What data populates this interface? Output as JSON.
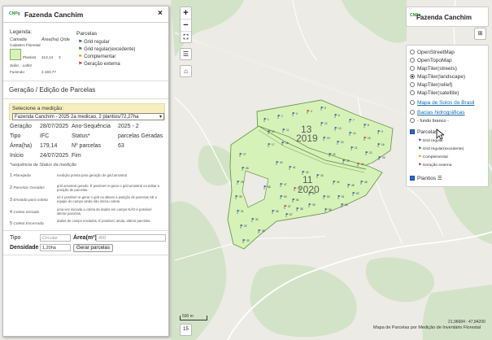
{
  "panel": {
    "title": "Fazenda Canchim",
    "logo_text": "CNPq",
    "legend": {
      "title": "Legenda:",
      "camada": "Camada",
      "area_qtde": "Área(ha) Qtde",
      "cadastro": "Cadastro Florestal",
      "plantios_label": "Plantios",
      "plantios_area": "413,14",
      "plantios_qtd": "3",
      "solos": "Solos - Lotlnt",
      "parcelas_col": "Fuzendo",
      "parcelas_val": "2.193,77",
      "parcelas_title": "Parcelas",
      "parcelas": [
        {
          "label": "Grid regular",
          "color": "#1a5fb4"
        },
        {
          "label": "Grid regular(excedente)",
          "color": "#2e7d32"
        },
        {
          "label": "Complementar",
          "color": "#f0a000"
        },
        {
          "label": "Geração externa",
          "color": "#d32f2f"
        }
      ]
    },
    "section_title": "Geração / Edição de Parcelas",
    "select_label": "Selecione a medição:",
    "select_value": "Fazenda Canchim - 2025 2a medicao, 2 plantios/72,27ha",
    "info": {
      "geracao_k": "Geração",
      "geracao_v": "28/07/2025",
      "ano_k": "Ano-Sequência",
      "ano_v": "2025 - 2",
      "tipo_k": "Tipo",
      "tipo_v": "IFC",
      "status_k": "Status*",
      "status_v": "parcelas Geradas",
      "area_k": "Área(ha)",
      "area_v": "179,14",
      "nparc_k": "Nº parcelas",
      "nparc_v": "63",
      "inicio_k": "Início",
      "inicio_v": "24/07/2025",
      "fim_k": "Fim",
      "fim_v": ""
    },
    "status_note": "*sequência de Status da medição",
    "statuses": [
      {
        "n": "1",
        "label": "Planejada",
        "desc": "medição pronta para geração de grid amostral"
      },
      {
        "n": "2",
        "label": "Parcelas Geradas",
        "desc": "grid amostral gerado. É possível re-gerar o grid amostral ou editar a posição de parcelas."
      },
      {
        "n": "3",
        "label": "Enviada para coleta",
        "desc": "só é possível re-gerar o grid ou alterar a posição de parcelas SE o equipe do campo ainda não iniciou coleta"
      },
      {
        "n": "4",
        "label": "Coleta Iniciada",
        "desc": "uma vez iniciada a coleta de dados em campo NÃO é possível alterar parcelas."
      },
      {
        "n": "5",
        "label": "Coleta Encerrada",
        "desc": "dados de campo enviados. É possível, ainda, alterar parcelas."
      }
    ],
    "tipo_label": "Tipo",
    "tipo_value": "Circular",
    "area_label": "Área(m²)",
    "area_value": "400",
    "densidade_label": "Densidade",
    "densidade_value": "1,20ha",
    "gerar_button": "Gerar parcelas"
  },
  "map": {
    "zoom_in": "+",
    "zoom_out": "−",
    "fullscreen_icon": "fullscreen-icon",
    "layers_icon": "list-icon",
    "home_icon": "home-icon",
    "compass_icon": "compass-icon",
    "plot1_label": "13",
    "plot1_year": "2019",
    "plot2_label": "11",
    "plot2_year": "2020",
    "scale_label": "500 m",
    "bottom_btn": "15",
    "coords": "21,96684 : 47,84200",
    "attribution": "Mapa de Parcelas por Medição de Inventário Florestal"
  },
  "titlebox": {
    "logo": "CNPq",
    "title": "Fazenda Canchim"
  },
  "layers": {
    "base": [
      {
        "label": "OpenStreetMap",
        "selected": false
      },
      {
        "label": "OpenTopoMap",
        "selected": false
      },
      {
        "label": "MapTiler(streets)",
        "selected": false
      },
      {
        "label": "MapTiler(landscape)",
        "selected": true
      },
      {
        "label": "MapTiler(relief)",
        "selected": false
      },
      {
        "label": "MapTiler(satellite)",
        "selected": false
      }
    ],
    "extra": [
      {
        "label": "Mapa de Solos do Brasil"
      },
      {
        "label": "Bacias hidrográficas"
      },
      {
        "label": "- fundo branco -"
      }
    ],
    "parcelas_label": "Parcelas",
    "parcelas_sub": [
      "Grid regular",
      "Grid regular(excedente)",
      "Complementar",
      "Geração externa"
    ],
    "plantios_label": "Plantios"
  }
}
